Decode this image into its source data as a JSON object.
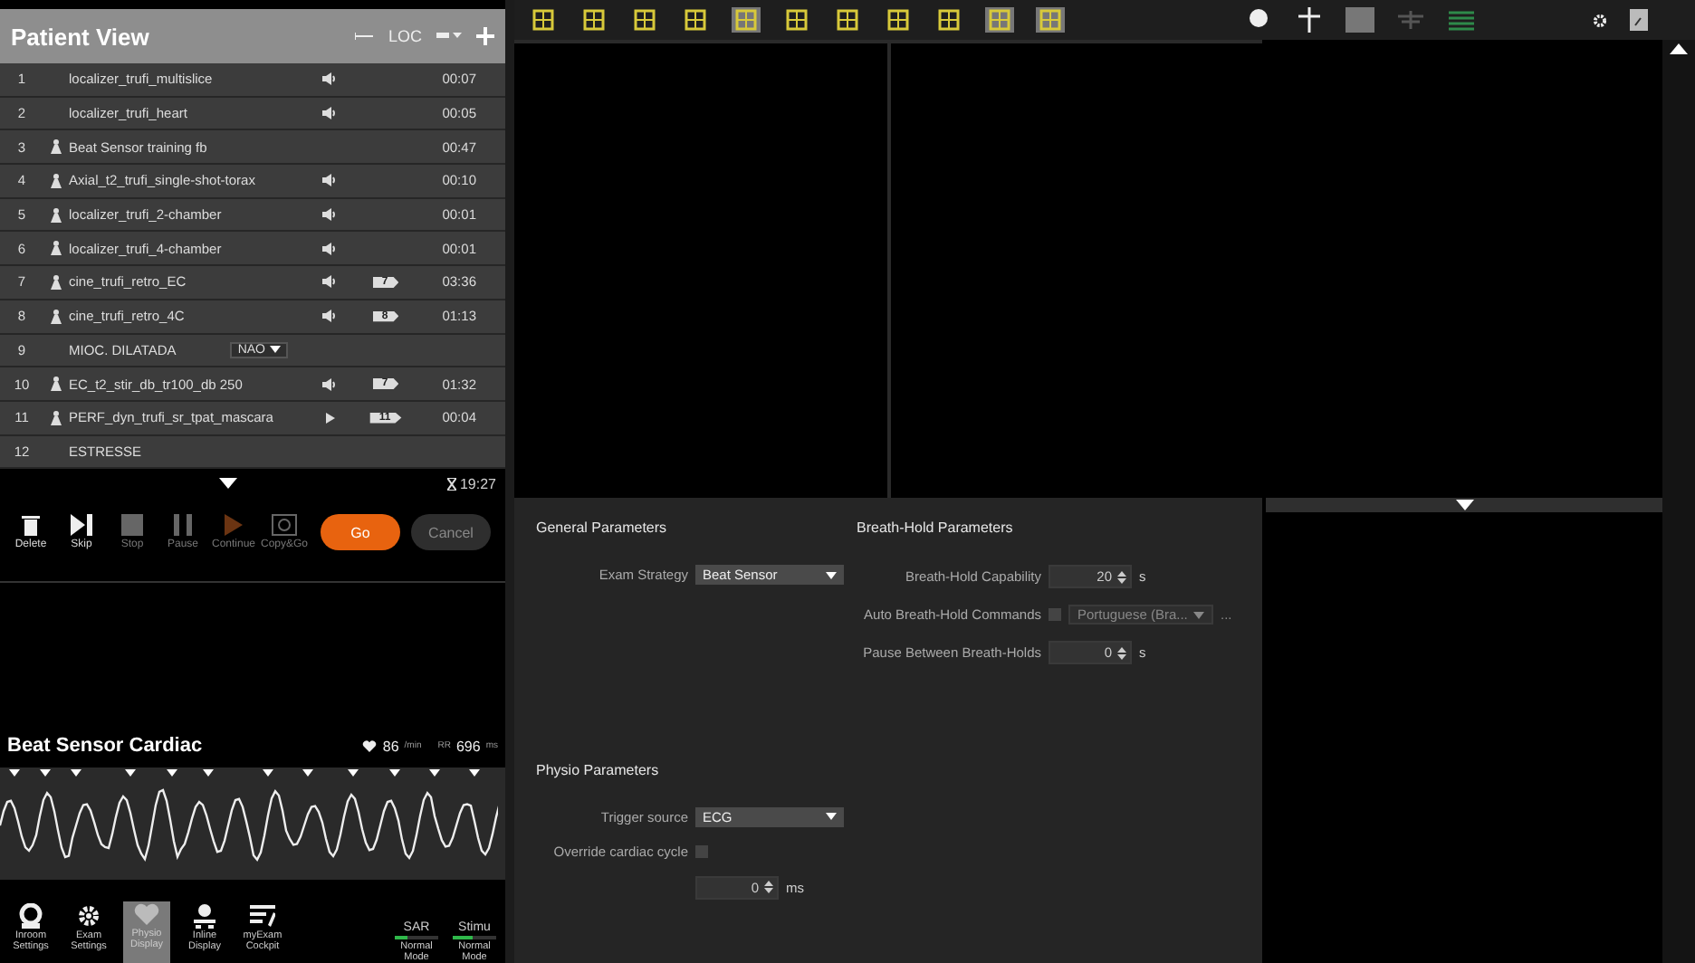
{
  "patient_view": {
    "title": "Patient View",
    "loc_label": "LOC",
    "rows": [
      {
        "number": "1",
        "name": "localizer_trufi_multislice",
        "person": false,
        "speaker": true,
        "play": false,
        "time": "00:07"
      },
      {
        "number": "2",
        "name": "localizer_trufi_heart",
        "person": false,
        "speaker": true,
        "play": false,
        "time": "00:05"
      },
      {
        "number": "3",
        "name": "Beat Sensor training fb",
        "person": true,
        "speaker": false,
        "play": false,
        "time": "00:47"
      },
      {
        "number": "4",
        "name": "Axial_t2_trufi_single-shot-torax",
        "person": true,
        "speaker": true,
        "play": false,
        "time": "00:10"
      },
      {
        "number": "5",
        "name": "localizer_trufi_2-chamber",
        "person": true,
        "speaker": true,
        "play": false,
        "time": "00:01"
      },
      {
        "number": "6",
        "name": "localizer_trufi_4-chamber",
        "person": true,
        "speaker": true,
        "play": false,
        "time": "00:01"
      },
      {
        "number": "7",
        "name": "cine_trufi_retro_EC",
        "person": true,
        "speaker": true,
        "play": false,
        "badge": "7",
        "time": "03:36"
      },
      {
        "number": "8",
        "name": "cine_trufi_retro_4C",
        "person": true,
        "speaker": true,
        "play": false,
        "badge": "8",
        "time": "01:13"
      },
      {
        "number": "9",
        "name": "MIOC. DILATADA",
        "person": false,
        "speaker": false,
        "play": false,
        "dropdown": "NAO"
      },
      {
        "number": "10",
        "name": "EC_t2_stir_db_tr100_db 250",
        "person": true,
        "speaker": true,
        "play": false,
        "badge": "7",
        "time": "01:32"
      },
      {
        "number": "11",
        "name": "PERF_dyn_trufi_sr_tpat_mascara",
        "person": true,
        "speaker": false,
        "play": true,
        "badge": "11",
        "time": "00:04"
      },
      {
        "number": "12",
        "name": "ESTRESSE",
        "person": false,
        "speaker": false,
        "play": false
      }
    ],
    "total_time": "19:27"
  },
  "controls": [
    {
      "kind": "delete",
      "label": "Delete",
      "disabled": false
    },
    {
      "kind": "skip",
      "label": "Skip",
      "disabled": false
    },
    {
      "kind": "stop",
      "label": "Stop",
      "disabled": true
    },
    {
      "kind": "pause",
      "label": "Pause",
      "disabled": true
    },
    {
      "kind": "continue",
      "label": "Continue",
      "disabled": true
    },
    {
      "kind": "copy",
      "label": "Copy&Go",
      "disabled": true
    }
  ],
  "go_button": {
    "label": "Go",
    "disabled": false
  },
  "cancel_button": {
    "label": "Cancel",
    "disabled": true
  },
  "physio": {
    "title": "Beat Sensor Cardiac",
    "heart_rate": "86",
    "heart_rate_unit": "/min",
    "rr_label": "RR",
    "rr": "696",
    "rr_unit": "ms"
  },
  "nav": [
    {
      "kind": "inroom",
      "label": "Inroom Settings",
      "selected": false
    },
    {
      "kind": "exam",
      "label": "Exam Settings",
      "selected": false
    },
    {
      "kind": "physio",
      "label": "Physio Display",
      "selected": true
    },
    {
      "kind": "inline",
      "label": "Inline Display",
      "selected": false
    },
    {
      "kind": "cockpit",
      "label": "myExam Cockpit",
      "selected": false
    }
  ],
  "meters": [
    {
      "label": "SAR",
      "level": 0.3,
      "mode": "Normal Mode"
    },
    {
      "label": "Stimu",
      "level": 0.45,
      "mode": "Normal Mode"
    }
  ],
  "parameters": {
    "general": {
      "title": "General Parameters",
      "fields": [
        {
          "kind": "dropdown",
          "label": "Exam Strategy",
          "value": "Beat Sensor"
        }
      ]
    },
    "breath_hold": {
      "title": "Breath-Hold Parameters",
      "fields": [
        {
          "kind": "spinner",
          "label": "Breath-Hold Capability",
          "value": "20",
          "unit": "s"
        },
        {
          "kind": "checkbox-dropdown",
          "label": "Auto Breath-Hold Commands",
          "checked": false,
          "value": "Portuguese (Bra...",
          "more": "..."
        },
        {
          "kind": "spinner",
          "label": "Pause Between Breath-Holds",
          "value": "0",
          "unit": "s"
        }
      ]
    },
    "physio": {
      "title": "Physio Parameters",
      "fields": [
        {
          "kind": "dropdown",
          "label": "Trigger source",
          "value": "ECG"
        },
        {
          "kind": "checkbox",
          "label": "Override cardiac cycle",
          "checked": false
        },
        {
          "kind": "spinner",
          "value": "0",
          "unit": "ms"
        }
      ]
    }
  }
}
